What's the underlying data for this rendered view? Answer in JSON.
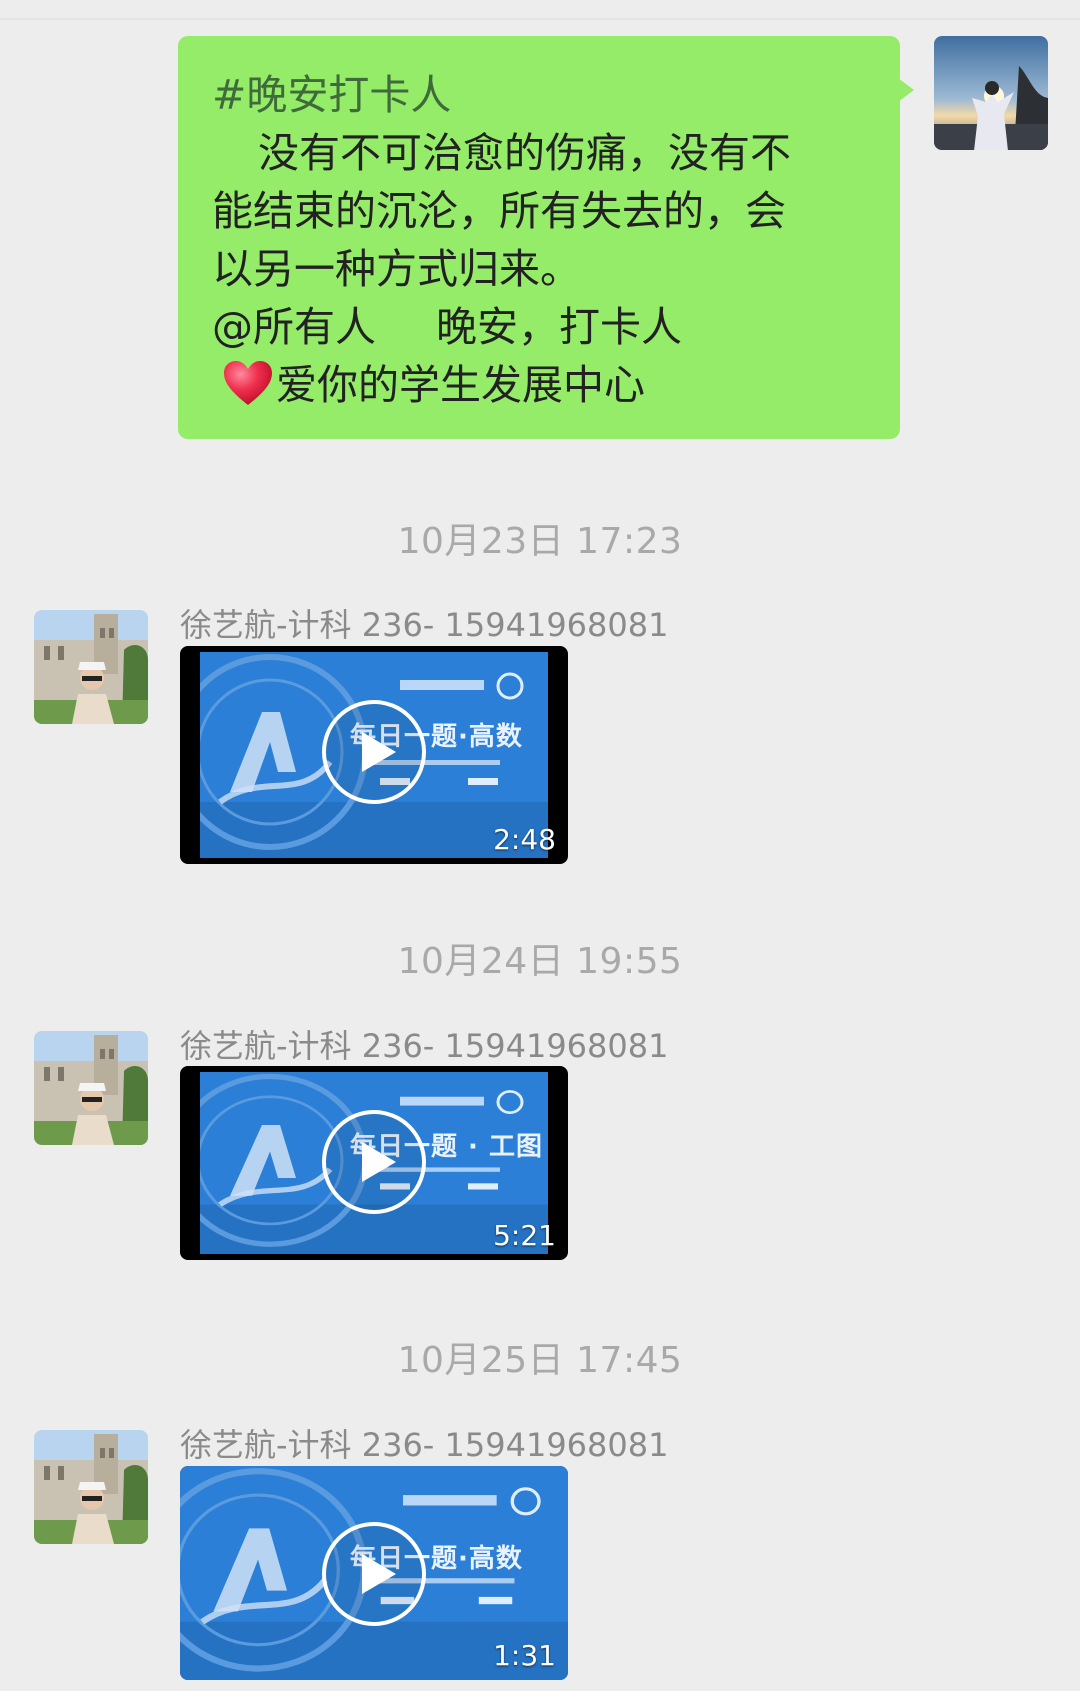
{
  "outgoing": {
    "hashtag": "#晚安打卡人",
    "line1": "没有不可治愈的伤痛，没有不",
    "line2": "能结束的沉沦，所有失去的，会",
    "line3": "以另一种方式归来。",
    "mention": "@所有人",
    "goodnight": "晚安，打卡人",
    "signature": "爱你的学生发展中心"
  },
  "messages": [
    {
      "time": "10月23日 17:23",
      "sender": "徐艺航-计科 236- 15941968081",
      "video_title": "每日一题·高数",
      "duration": "2:48"
    },
    {
      "time": "10月24日 19:55",
      "sender": "徐艺航-计科 236- 15941968081",
      "video_title": "每日一题 · 工图",
      "duration": "5:21"
    },
    {
      "time": "10月25日 17:45",
      "sender": "徐艺航-计科 236- 15941968081",
      "video_title": "每日一题·高数",
      "duration": "1:31"
    }
  ],
  "icons": {
    "heart": "red-heart-icon",
    "play": "play-icon"
  },
  "colors": {
    "background": "#ededed",
    "outgoing_bubble": "#95ec69",
    "video_blue": "#2a7fd4",
    "timestamp": "#a9a9a9"
  }
}
